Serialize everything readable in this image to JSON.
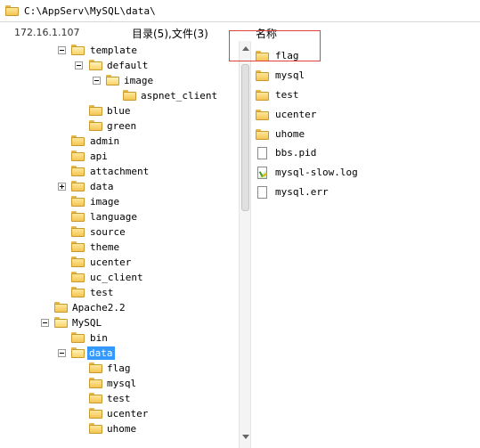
{
  "path_bar": {
    "path": "C:\\AppServ\\MySQL\\data\\"
  },
  "header": {
    "host": "172.16.1.107",
    "summary": "目录(5),文件(3)",
    "column_name": "名称"
  },
  "tree": [
    {
      "label": "template",
      "expander": "minus"
    },
    {
      "label": "default",
      "expander": "minus"
    },
    {
      "label": "image",
      "expander": "minus"
    },
    {
      "label": "aspnet_client",
      "expander": null
    },
    {
      "label": "blue",
      "expander": null
    },
    {
      "label": "green",
      "expander": null
    },
    {
      "label": "admin",
      "expander": null
    },
    {
      "label": "api",
      "expander": null
    },
    {
      "label": "attachment",
      "expander": null
    },
    {
      "label": "data",
      "expander": "plus"
    },
    {
      "label": "image",
      "expander": null
    },
    {
      "label": "language",
      "expander": null
    },
    {
      "label": "source",
      "expander": null
    },
    {
      "label": "theme",
      "expander": null
    },
    {
      "label": "ucenter",
      "expander": null
    },
    {
      "label": "uc_client",
      "expander": null
    },
    {
      "label": "test",
      "expander": null
    },
    {
      "label": "Apache2.2",
      "expander": null
    },
    {
      "label": "MySQL",
      "expander": "minus"
    },
    {
      "label": "bin",
      "expander": null
    },
    {
      "label": "data",
      "expander": "minus",
      "selected": true
    },
    {
      "label": "flag",
      "expander": null
    },
    {
      "label": "mysql",
      "expander": null
    },
    {
      "label": "test",
      "expander": null
    },
    {
      "label": "ucenter",
      "expander": null
    },
    {
      "label": "uhome",
      "expander": null
    }
  ],
  "files": [
    {
      "name": "flag",
      "icon": "folder"
    },
    {
      "name": "mysql",
      "icon": "folder"
    },
    {
      "name": "test",
      "icon": "folder"
    },
    {
      "name": "ucenter",
      "icon": "folder"
    },
    {
      "name": "uhome",
      "icon": "folder"
    },
    {
      "name": "bbs.pid",
      "icon": "file"
    },
    {
      "name": "mysql-slow.log",
      "icon": "log-file"
    },
    {
      "name": "mysql.err",
      "icon": "file"
    }
  ],
  "colors": {
    "selection": "#3399ff",
    "highlight_box": "#e0413f",
    "folder": "#f4c554"
  }
}
